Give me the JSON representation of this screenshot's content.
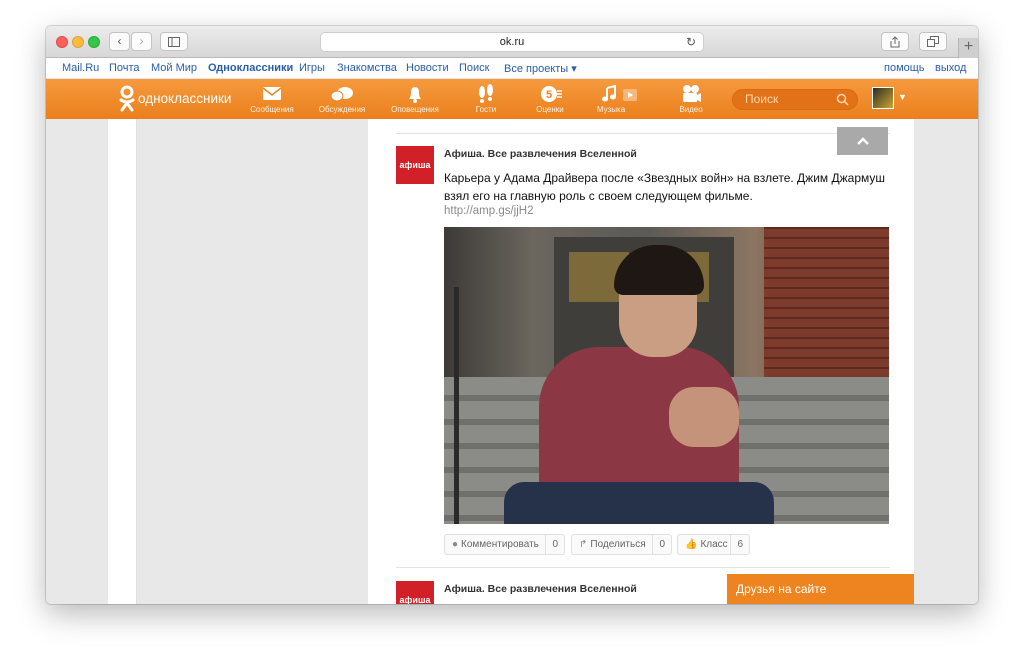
{
  "browser": {
    "url": "ok.ru",
    "reload_icon": "reload-icon",
    "back_icon": "chevron-left-icon",
    "forward_icon": "chevron-right-icon",
    "sidebar_icon": "sidebar-icon",
    "share_icon": "share-icon",
    "tabs_icon": "tabs-icon",
    "new_tab_icon": "plus-icon"
  },
  "portal": {
    "links": [
      "Mail.Ru",
      "Почта",
      "Мой Мир",
      "Одноклассники",
      "Игры",
      "Знакомства",
      "Новости",
      "Поиск",
      "Все проекты ▾"
    ],
    "right_links": [
      "помощь",
      "выход"
    ]
  },
  "nav": {
    "logo": "одноклассники",
    "items": [
      {
        "label": "Сообщения",
        "icon": "envelope-icon"
      },
      {
        "label": "Обсуждения",
        "icon": "chat-icon"
      },
      {
        "label": "Оповещения",
        "icon": "bell-icon"
      },
      {
        "label": "Гости",
        "icon": "footprints-icon"
      },
      {
        "label": "Оценки",
        "icon": "rating-icon"
      },
      {
        "label": "Музыка",
        "icon": "music-icon"
      },
      {
        "label": "Видео",
        "icon": "video-camera-icon"
      }
    ],
    "search_placeholder": "Поиск",
    "brand_color": "#ee8420"
  },
  "feed": {
    "posts": [
      {
        "logo": "афиша",
        "author": "Афиша. Все развлечения Вселенной",
        "text": "Карьера у Адама Драйвера после «Звездных войн» на взлете. Джим Джармуш взял его на главную роль с своем следующем фильме.",
        "link": "http://amp.gs/jjH2",
        "actions": [
          {
            "label": "Комментировать",
            "count": "0",
            "icon": "comment-icon"
          },
          {
            "label": "Поделиться",
            "count": "0",
            "icon": "share-arrow-icon"
          },
          {
            "label": "Класс",
            "count": "6",
            "icon": "thumbs-up-icon"
          }
        ]
      },
      {
        "logo": "афиша",
        "author": "Афиша. Все развлечения Вселенной"
      }
    ]
  },
  "friends_bar": "Друзья на сайте",
  "accent_color": "#d12027"
}
